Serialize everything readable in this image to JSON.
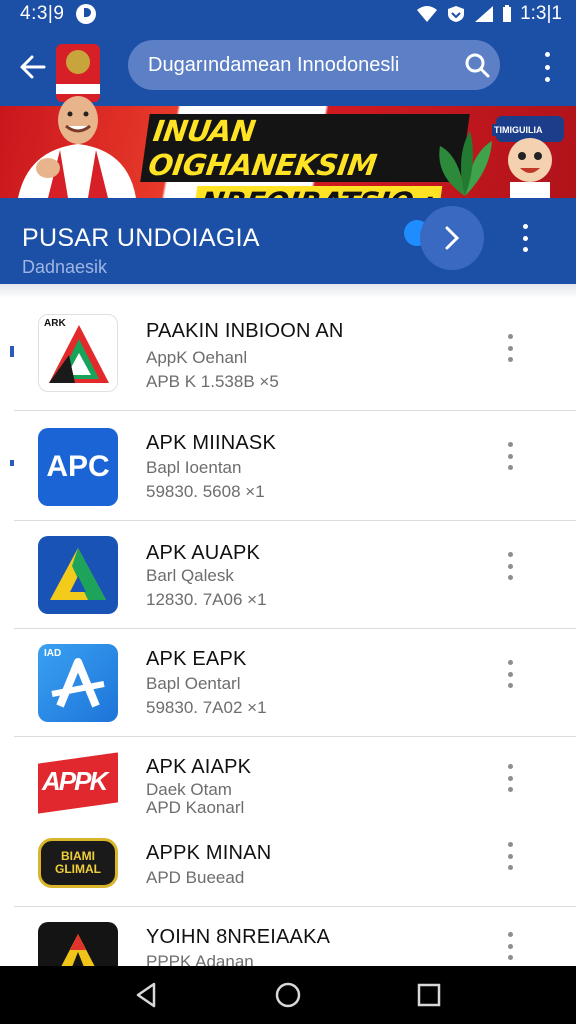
{
  "status_bar": {
    "time_left": "4:3|9",
    "time_right": "1:3|1"
  },
  "app_bar": {
    "search_text": "Dugarındamean Innodonesli"
  },
  "banner": {
    "line1": "INUAN OIGHANEKSIM",
    "line2": "NREOIRATSIO :",
    "badge_text": "TIMIGUILIA"
  },
  "section": {
    "title": "PUSAR UNDOIAGIA",
    "subtitle": "Dadnaesik"
  },
  "apps": [
    {
      "name": "PAAKIN INBIOON AN",
      "line2": "AppK Oehanl",
      "line3": "APB  K 1.538B ×5",
      "icon": "red-green-a-icon",
      "icon_label": "ARK"
    },
    {
      "name": "APK MIINASK",
      "line2": "Bapl Ioentan",
      "line3": "59830. 5608 ×1",
      "icon": "apc-logo-icon",
      "icon_label": "APC"
    },
    {
      "name": "APK AUAPK",
      "line2": "Barl Qalesk",
      "line3": "12830. 7A06 ×1",
      "icon": "yellow-green-a-icon",
      "icon_label": ""
    },
    {
      "name": "APK EAPK",
      "line2": "Bapl Oentarl",
      "line3": "59830. 7A02 ×1",
      "icon": "blue-a-icon",
      "icon_label": "IAD"
    },
    {
      "name": "APK AIAPK",
      "line2": "Daek Otam",
      "line3": "APD Kaonarl",
      "icon": "red-apk-tag-icon",
      "icon_label": "APPK"
    },
    {
      "name": "APPK MINAN",
      "line2": "APD Bueead",
      "line3": "",
      "icon": "gold-badge-icon",
      "icon_label": "BIAMI GLIMAL"
    },
    {
      "name": "YOIHN 8NREIAAKA",
      "line2": "PPPK Adanan",
      "line3": "",
      "icon": "black-yellow-a-icon",
      "icon_label": ""
    }
  ],
  "colors": {
    "primary": "#1c4fa6",
    "accent_yellow": "#ffe324",
    "banner_red": "#c9161d"
  }
}
